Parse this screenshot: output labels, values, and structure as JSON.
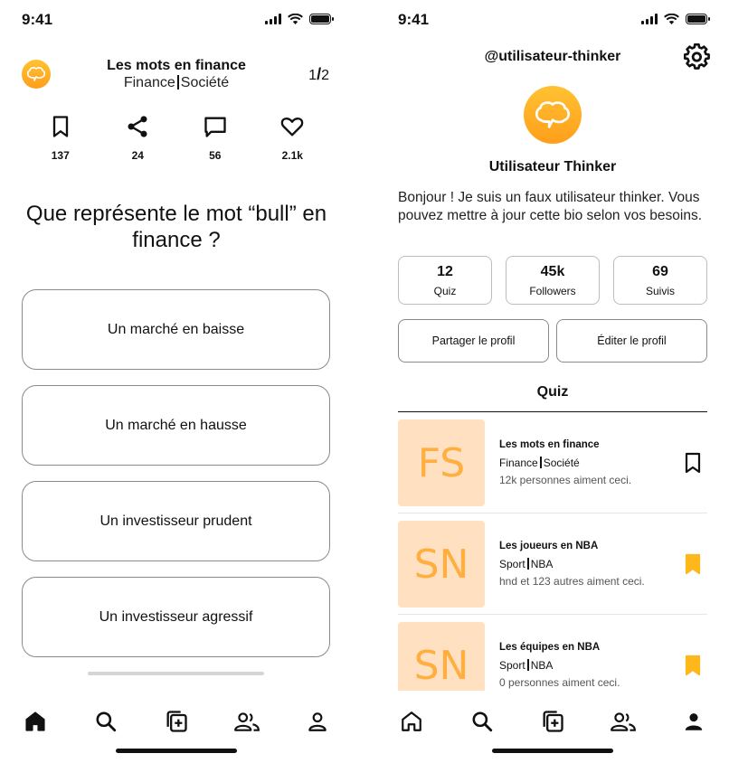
{
  "status": {
    "time": "9:41"
  },
  "quiz_screen": {
    "title": "Les mots en finance",
    "category1": "Finance",
    "category2": "Société",
    "page_current": "1",
    "page_total": "2",
    "stats": {
      "bookmarks": "137",
      "shares": "24",
      "comments": "56",
      "likes": "2.1k"
    },
    "question": "Que représente le mot “bull” en finance ?",
    "answers": [
      "Un marché en baisse",
      "Un marché en hausse",
      "Un investisseur prudent",
      "Un investisseur agressif"
    ]
  },
  "profile_screen": {
    "handle": "@utilisateur-thinker",
    "name": "Utilisateur Thinker",
    "bio": "Bonjour ! Je suis un faux utilisateur thinker. Vous pouvez mettre à jour cette bio selon vos besoins.",
    "stats": [
      {
        "value": "12",
        "label": "Quiz"
      },
      {
        "value": "45k",
        "label": "Followers"
      },
      {
        "value": "69",
        "label": "Suivis"
      }
    ],
    "share_button": "Partager le profil",
    "edit_button": "Éditer le profil",
    "section_title": "Quiz",
    "quizzes": [
      {
        "initials": "FS",
        "title": "Les mots en finance",
        "cat1": "Finance",
        "cat2": "Société",
        "likes": "12k personnes aiment ceci.",
        "bookmarked": false
      },
      {
        "initials": "SN",
        "title": "Les joueurs en NBA",
        "cat1": "Sport",
        "cat2": "NBA",
        "likes": "hnd et 123 autres aiment ceci.",
        "bookmarked": true
      },
      {
        "initials": "SN",
        "title": "Les équipes en NBA",
        "cat1": "Sport",
        "cat2": "NBA",
        "likes": "0 personnes aiment ceci.",
        "bookmarked": true
      }
    ]
  },
  "colors": {
    "accent": "#FFB81C",
    "thumb_bg": "#FFE1C2",
    "thumb_text": "#FFAE40"
  },
  "icons": [
    "home-icon",
    "search-icon",
    "add-quiz-icon",
    "friends-icon",
    "profile-icon",
    "bookmark-icon",
    "share-icon",
    "comment-icon",
    "heart-icon",
    "gear-icon",
    "brain-icon"
  ]
}
